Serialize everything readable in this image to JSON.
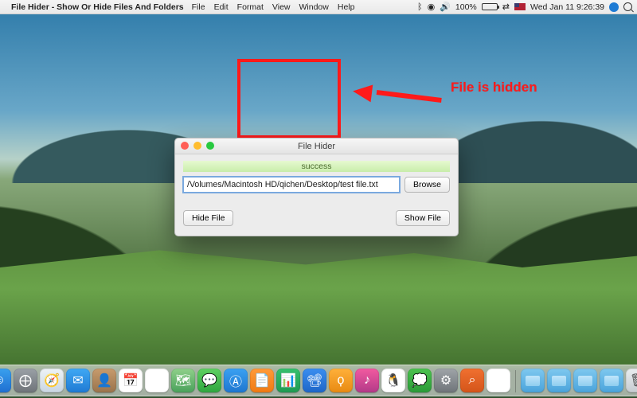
{
  "menubar": {
    "app_title": "File Hider - Show Or Hide Files And Folders",
    "items": [
      "File",
      "Edit",
      "Format",
      "View",
      "Window",
      "Help"
    ],
    "status": {
      "battery_pct": "100%",
      "clock": "Wed Jan 11  9:26:39"
    }
  },
  "annotation": {
    "label": "File is hidden"
  },
  "window": {
    "title": "File Hider",
    "status_text": "success",
    "path_value": "/Volumes/Macintosh HD/qichen/Desktop/test file.txt",
    "browse_label": "Browse",
    "hide_label": "Hide File",
    "show_label": "Show File"
  },
  "dock": {
    "apps": [
      {
        "name": "finder",
        "bg": "linear-gradient(#39a0ee,#1f6fd1)",
        "glyph": "☺"
      },
      {
        "name": "launchpad",
        "bg": "linear-gradient(#9aa0a6,#6f7479)",
        "glyph": "⨁"
      },
      {
        "name": "safari",
        "bg": "linear-gradient(#eef3f7,#c9d6e2)",
        "glyph": "🧭"
      },
      {
        "name": "mail",
        "bg": "linear-gradient(#3fa8f4,#1f7ad3)",
        "glyph": "✉"
      },
      {
        "name": "contacts",
        "bg": "linear-gradient(#c79b6d,#9a744c)",
        "glyph": "👤"
      },
      {
        "name": "calendar",
        "bg": "#ffffff",
        "glyph": "📅"
      },
      {
        "name": "reminders",
        "bg": "#ffffff",
        "glyph": "☑"
      },
      {
        "name": "maps",
        "bg": "linear-gradient(#8fd08a,#4aa15b)",
        "glyph": "🗺"
      },
      {
        "name": "messages",
        "bg": "linear-gradient(#5fd062,#2fa63f)",
        "glyph": "💬"
      },
      {
        "name": "appstore",
        "bg": "linear-gradient(#3aa1f2,#1e76d0)",
        "glyph": "Ⓐ"
      },
      {
        "name": "pages",
        "bg": "linear-gradient(#ff9a3a,#f07a12)",
        "glyph": "📄"
      },
      {
        "name": "numbers",
        "bg": "linear-gradient(#36c06e,#1f9a52)",
        "glyph": "📊"
      },
      {
        "name": "keynote",
        "bg": "linear-gradient(#3a8ef0,#1e66c8)",
        "glyph": "📽"
      },
      {
        "name": "movavi",
        "bg": "linear-gradient(#ffb03a,#e88a12)",
        "glyph": "ϙ"
      },
      {
        "name": "itunes",
        "bg": "linear-gradient(#f25aa0,#b33a88)",
        "glyph": "♪"
      },
      {
        "name": "qq",
        "bg": "#ffffff",
        "glyph": "🐧"
      },
      {
        "name": "wechat",
        "bg": "linear-gradient(#4cc24f,#2a9a38)",
        "glyph": "💭"
      },
      {
        "name": "preferences",
        "bg": "linear-gradient(#9fa4a8,#6f7479)",
        "glyph": "⚙"
      },
      {
        "name": "duplicate-finder",
        "bg": "linear-gradient(#f07030,#d4551a)",
        "glyph": "⌕"
      },
      {
        "name": "cloud-app",
        "bg": "#ffffff",
        "glyph": "☁"
      }
    ],
    "folders": [
      "folder-blue-1",
      "folder-blue-2",
      "folder-blue-3",
      "folder-blue-4"
    ],
    "trash": {
      "name": "trash",
      "glyph": "🗑"
    }
  }
}
